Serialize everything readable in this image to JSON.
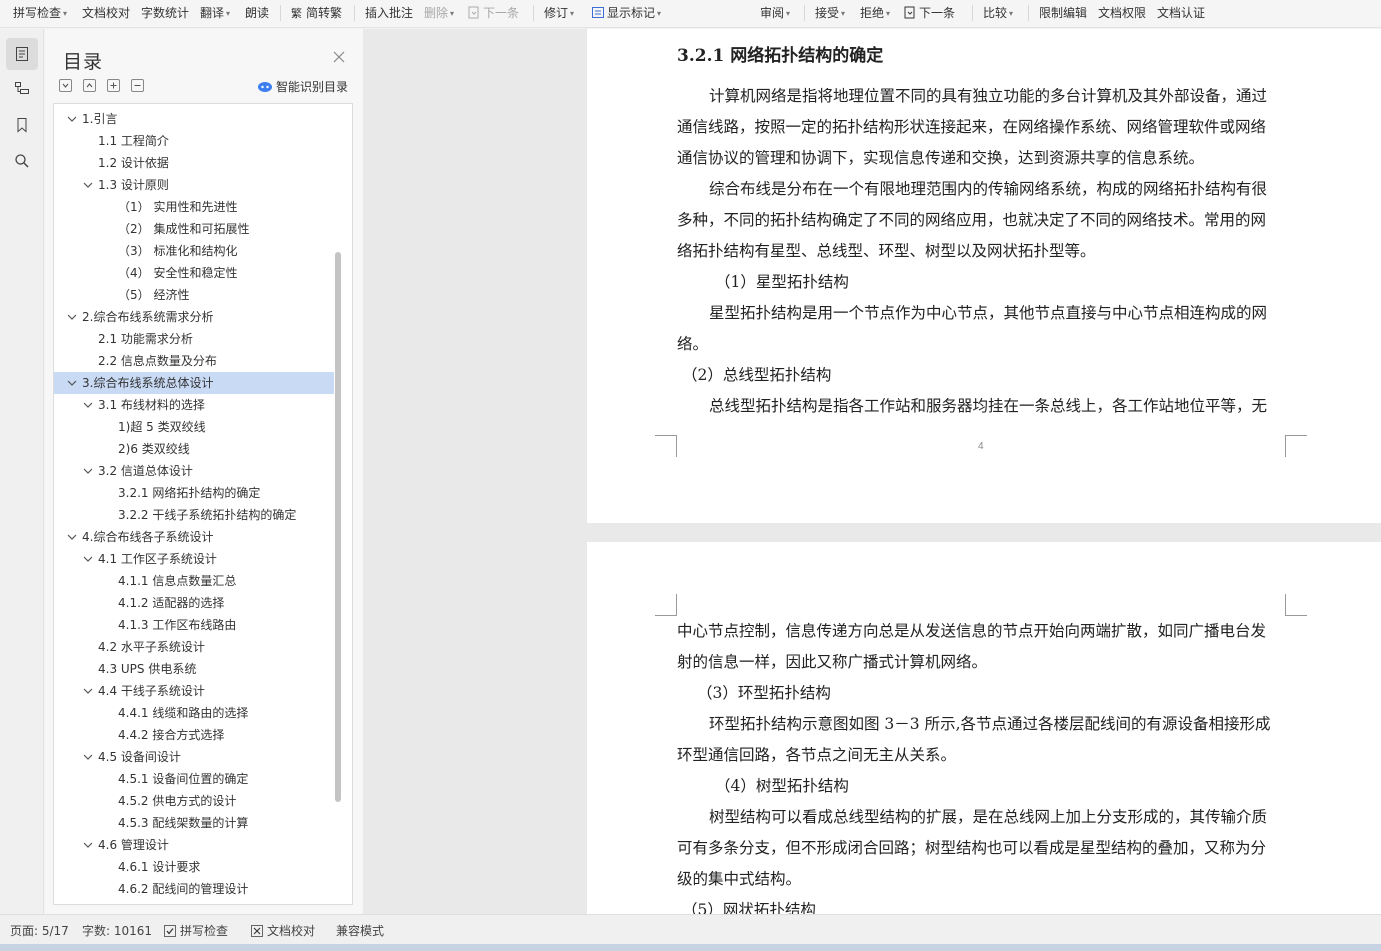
{
  "toolbar": {
    "spell_check": "拼写检查",
    "doc_proof": "文档校对",
    "word_count": "字数统计",
    "translate": "翻译",
    "read_aloud": "朗读",
    "simp_trad": "简转繁",
    "insert_comment": "插入批注",
    "delete": "删除",
    "next_item": "下一条",
    "revise": "修订",
    "show_markup": "显示标记",
    "review": "审阅",
    "accept": "接受",
    "reject": "拒绝",
    "next_change": "下一条",
    "compare": "比较",
    "restrict_edit": "限制编辑",
    "doc_permission": "文档权限",
    "doc_certify": "文档认证"
  },
  "toc": {
    "title": "目录",
    "ai_label": "智能识别目录",
    "items": [
      {
        "label": "1.引言",
        "level": 1,
        "expanded": true
      },
      {
        "label": "1.1 工程简介",
        "level": 2
      },
      {
        "label": "1.2 设计依据",
        "level": 2
      },
      {
        "label": "1.3 设计原则",
        "level": 2,
        "expanded": true
      },
      {
        "label": "（1） 实用性和先进性",
        "level": 3
      },
      {
        "label": "（2） 集成性和可拓展性",
        "level": 3
      },
      {
        "label": "（3） 标准化和结构化",
        "level": 3
      },
      {
        "label": "（4） 安全性和稳定性",
        "level": 3
      },
      {
        "label": "（5） 经济性",
        "level": 3
      },
      {
        "label": "2.综合布线系统需求分析",
        "level": 1,
        "expanded": true
      },
      {
        "label": "2.1 功能需求分析",
        "level": 2
      },
      {
        "label": "2.2 信息点数量及分布",
        "level": 2
      },
      {
        "label": "3.综合布线系统总体设计",
        "level": 1,
        "expanded": true,
        "selected": true
      },
      {
        "label": "3.1 布线材料的选择",
        "level": 2,
        "expanded": true
      },
      {
        "label": "1)超 5 类双绞线",
        "level": 3
      },
      {
        "label": "2)6 类双绞线",
        "level": 3
      },
      {
        "label": "3.2 信道总体设计",
        "level": 2,
        "expanded": true
      },
      {
        "label": "3.2.1 网络拓扑结构的确定",
        "level": 3
      },
      {
        "label": "3.2.2 干线子系统拓扑结构的确定",
        "level": 3
      },
      {
        "label": "4.综合布线各子系统设计",
        "level": 1,
        "expanded": true
      },
      {
        "label": "4.1 工作区子系统设计",
        "level": 2,
        "expanded": true
      },
      {
        "label": "4.1.1 信息点数量汇总",
        "level": 3
      },
      {
        "label": "4.1.2 适配器的选择",
        "level": 3
      },
      {
        "label": "4.1.3 工作区布线路由",
        "level": 3
      },
      {
        "label": "4.2 水平子系统设计",
        "level": 2
      },
      {
        "label": "4.3 UPS 供电系统",
        "level": 2
      },
      {
        "label": "4.4 干线子系统设计",
        "level": 2,
        "expanded": true
      },
      {
        "label": "4.4.1 线缆和路由的选择",
        "level": 3
      },
      {
        "label": "4.4.2 接合方式选择",
        "level": 3
      },
      {
        "label": "4.5 设备间设计",
        "level": 2,
        "expanded": true
      },
      {
        "label": "4.5.1 设备间位置的确定",
        "level": 3
      },
      {
        "label": "4.5.2 供电方式的设计",
        "level": 3
      },
      {
        "label": "4.5.3 配线架数量的计算",
        "level": 3
      },
      {
        "label": "4.6 管理设计",
        "level": 2,
        "expanded": true
      },
      {
        "label": "4.6.1 设计要求",
        "level": 3
      },
      {
        "label": "4.6.2 配线间的管理设计",
        "level": 3
      }
    ]
  },
  "page1": {
    "heading": "3.2.1 网络拓扑结构的确定",
    "lines": [
      "计算机网络是指将地理位置不同的具有独立功能的多台计算机及其外部设备，通过",
      "通信线路，按照一定的拓扑结构形状连接起来，在网络操作系统、网络管理软件或网络",
      "通信协议的管理和协调下，实现信息传递和交换，达到资源共享的信息系统。",
      "综合布线是分布在一个有限地理范围内的传输网络系统，构成的网络拓扑结构有很",
      "多种，不同的拓扑结构确定了不同的网络应用，也就决定了不同的网络技术。常用的网",
      "络拓扑结构有星型、总线型、环型、树型以及网状拓扑型等。",
      "（1）星型拓扑结构",
      "星型拓扑结构是用一个节点作为中心节点，其他节点直接与中心节点相连构成的网",
      "络。",
      "（2）总线型拓扑结构",
      "总线型拓扑结构是指各工作站和服务器均挂在一条总线上，各工作站地位平等，无"
    ],
    "page_number": "4"
  },
  "page2": {
    "lines": [
      "中心节点控制，信息传递方向总是从发送信息的节点开始向两端扩散，如同广播电台发",
      "射的信息一样，因此又称广播式计算机网络。",
      "（3）环型拓扑结构",
      "环型拓扑结构示意图如图 3－3 所示,各节点通过各楼层配线间的有源设备相接形成",
      "环型通信回路，各节点之间无主从关系。",
      "（4）树型拓扑结构",
      "树型结构可以看成总线型结构的扩展，是在总线网上加上分支形成的，其传输介质",
      "可有多条分支，但不形成闭合回路；树型结构也可以看成是星型结构的叠加，又称为分",
      "级的集中式结构。",
      "（5）网状拓扑结构"
    ]
  },
  "status": {
    "page": "页面: 5/17",
    "words": "字数: 10161",
    "spell": "拼写检查",
    "proof": "文档校对",
    "compat": "兼容模式"
  }
}
